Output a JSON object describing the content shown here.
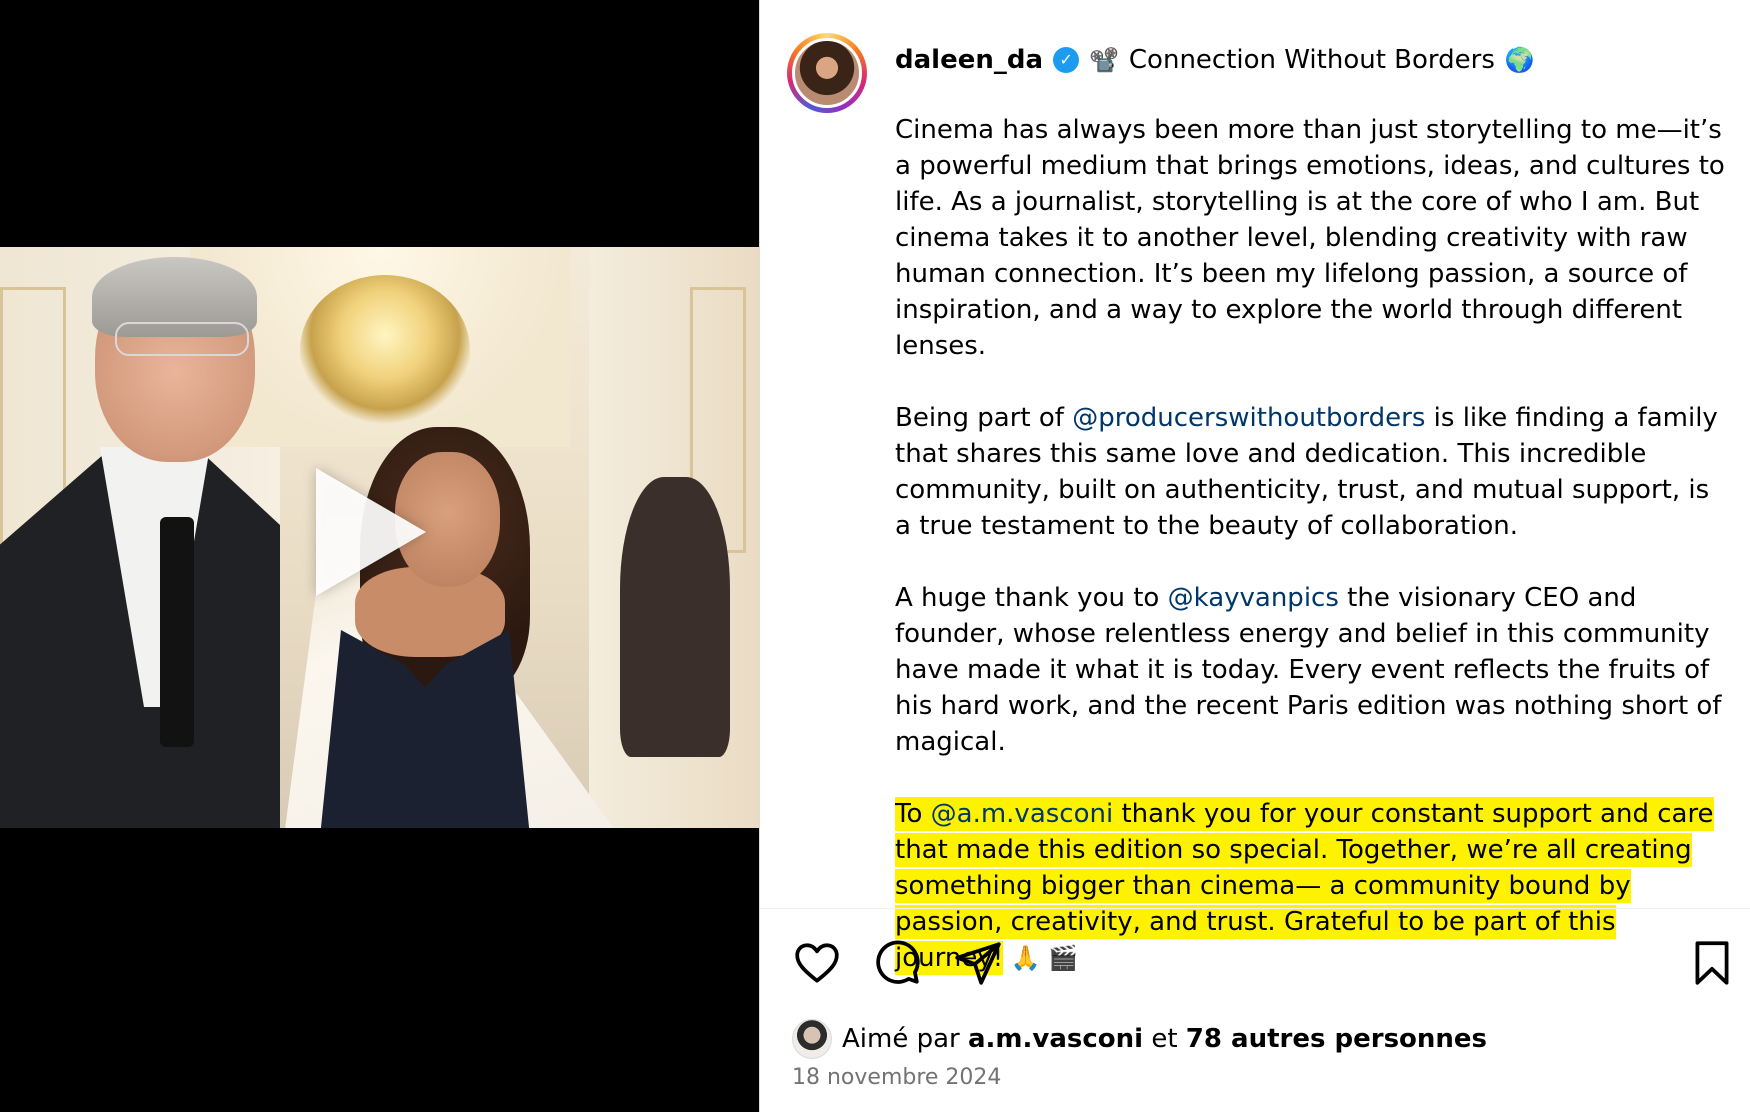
{
  "post": {
    "username": "daleen_da",
    "verified_symbol": "✓",
    "title_emoji": "📽️",
    "title": "Connection Without Borders",
    "title_end_emoji": "🌍",
    "paragraph1": "Cinema has always been more than just storytelling to me—it’s a powerful medium that brings emotions, ideas, and cultures to life. As a journalist, storytelling is at the core of who I am. But cinema takes it to another level, blending creativity with raw human connection. It’s been my lifelong passion, a source of inspiration, and a way to explore the world through different lenses.",
    "paragraph2": {
      "before": "Being part of ",
      "mention": "@producerswithoutborders",
      "after": " is like finding a family that shares this same love and dedication. This incredible community, built on authenticity, trust, and mutual support, is a true testament to the beauty of collaboration."
    },
    "paragraph3": {
      "before": "A huge thank you to ",
      "mention": "@kayvanpics",
      "after": " the visionary CEO and founder, whose relentless energy and belief in this community have made it what it is today. Every event reflects the fruits of his hard work, and the recent Paris edition was nothing short of magical."
    },
    "paragraph4": {
      "before": " To ",
      "mention": "@a.m.vasconi",
      "after": " thank you for your constant support and care that made this edition so special. Together, we’re all creating something bigger than cinema— a community bound by passion, creativity, and trust. Grateful to be part of this journey!",
      "end_emojis": " 🙏 🎬"
    }
  },
  "actions": {
    "like_icon": "heart-icon",
    "comment_icon": "comment-bubble-icon",
    "share_icon": "paper-plane-icon",
    "save_icon": "bookmark-icon"
  },
  "likes": {
    "prefix": "Aimé par ",
    "user": "a.m.vasconi",
    "middle": " et ",
    "others": "78 autres personnes"
  },
  "date": "18 novembre 2024",
  "colors": {
    "mention": "#00376b",
    "highlight": "#fff200",
    "date_gray": "#737373"
  }
}
